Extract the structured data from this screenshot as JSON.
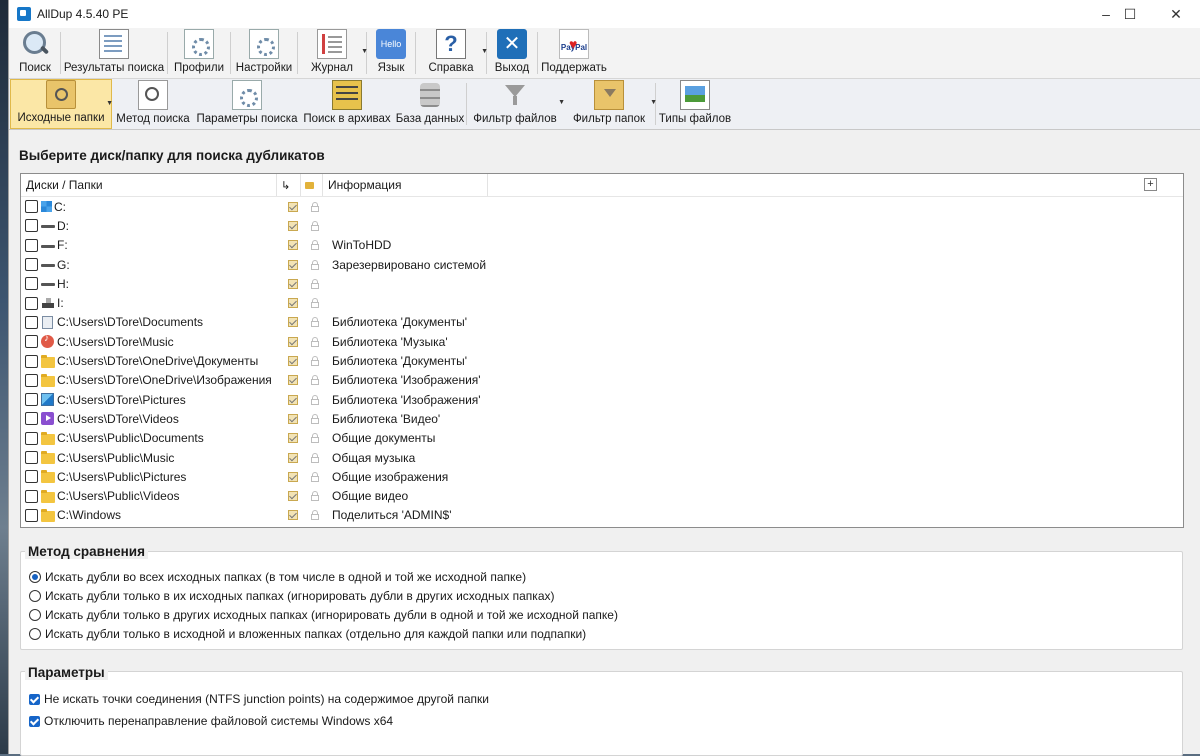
{
  "window": {
    "title": "AllDup 4.5.40 PE"
  },
  "toolbar_main": [
    {
      "label": "Поиск",
      "icon": "search-icon"
    },
    {
      "label": "Результаты поиска",
      "icon": "results-icon"
    },
    {
      "label": "Профили",
      "icon": "profiles-icon"
    },
    {
      "label": "Настройки",
      "icon": "settings-icon"
    },
    {
      "label": "Журнал",
      "icon": "journal-icon"
    },
    {
      "label": "Язык",
      "icon": "language-icon",
      "icon_text": "Hello"
    },
    {
      "label": "Справка",
      "icon": "help-icon"
    },
    {
      "label": "Выход",
      "icon": "exit-icon"
    },
    {
      "label": "Поддержать",
      "icon": "paypal-icon",
      "icon_text": "PayPal"
    }
  ],
  "toolbar_sub": [
    {
      "label": "Исходные папки",
      "icon": "source-folders-icon"
    },
    {
      "label": "Метод поиска",
      "icon": "search-method-icon"
    },
    {
      "label": "Параметры поиска",
      "icon": "search-params-icon"
    },
    {
      "label": "Поиск в архивах",
      "icon": "archive-icon"
    },
    {
      "label": "База данных",
      "icon": "database-icon"
    },
    {
      "label": "Фильтр файлов",
      "icon": "file-filter-icon"
    },
    {
      "label": "Фильтр папок",
      "icon": "folder-filter-icon"
    },
    {
      "label": "Типы файлов",
      "icon": "file-types-icon"
    }
  ],
  "source": {
    "heading": "Выберите диск/папку для поиска дубликатов",
    "columns": {
      "name": "Диски / Папки",
      "info": "Информация"
    },
    "rows": [
      {
        "name": "C:",
        "info": "",
        "icon": "windows-drive-icon"
      },
      {
        "name": "D:",
        "info": "",
        "icon": "drive-icon"
      },
      {
        "name": "F:",
        "info": "WinToHDD",
        "icon": "drive-icon"
      },
      {
        "name": "G:",
        "info": "Зарезервировано системой",
        "icon": "drive-icon"
      },
      {
        "name": "H:",
        "info": "",
        "icon": "drive-icon"
      },
      {
        "name": "I:",
        "info": "",
        "icon": "usb-drive-icon"
      },
      {
        "name": "C:\\Users\\DTore\\Documents",
        "info": "Библиотека 'Документы'",
        "icon": "documents-icon"
      },
      {
        "name": "C:\\Users\\DTore\\Music",
        "info": "Библиотека 'Музыка'",
        "icon": "music-icon"
      },
      {
        "name": "C:\\Users\\DTore\\OneDrive\\Документы",
        "info": "Библиотека 'Документы'",
        "icon": "folder-icon"
      },
      {
        "name": "C:\\Users\\DTore\\OneDrive\\Изображения",
        "info": "Библиотека 'Изображения'",
        "icon": "folder-icon"
      },
      {
        "name": "C:\\Users\\DTore\\Pictures",
        "info": "Библиотека 'Изображения'",
        "icon": "pictures-icon"
      },
      {
        "name": "C:\\Users\\DTore\\Videos",
        "info": "Библиотека 'Видео'",
        "icon": "videos-icon"
      },
      {
        "name": "C:\\Users\\Public\\Documents",
        "info": "Общие документы",
        "icon": "folder-icon"
      },
      {
        "name": "C:\\Users\\Public\\Music",
        "info": "Общая музыка",
        "icon": "folder-icon"
      },
      {
        "name": "C:\\Users\\Public\\Pictures",
        "info": "Общие изображения",
        "icon": "folder-icon"
      },
      {
        "name": "C:\\Users\\Public\\Videos",
        "info": "Общие видео",
        "icon": "folder-icon"
      },
      {
        "name": "C:\\Windows",
        "info": "Поделиться 'ADMIN$'",
        "icon": "folder-icon"
      }
    ]
  },
  "compare_method": {
    "title": "Метод сравнения",
    "selected": 0,
    "options": [
      "Искать дубли во всех исходных папках (в том числе в одной и той же исходной папке)",
      "Искать дубли только в их исходных папках (игнорировать дубли в других исходных папках)",
      "Искать дубли только в других исходных папках (игнорировать дубли в одной и той же исходной папке)",
      "Искать дубли только в исходной и вложенных папках (отдельно для каждой папки или подпапки)"
    ]
  },
  "params": {
    "title": "Параметры",
    "options": [
      {
        "label": "Не искать точки соединения (NTFS junction points) на содержимое другой папки",
        "checked": true
      },
      {
        "label": "Отключить перенаправление файловой системы Windows x64",
        "checked": true
      }
    ]
  }
}
